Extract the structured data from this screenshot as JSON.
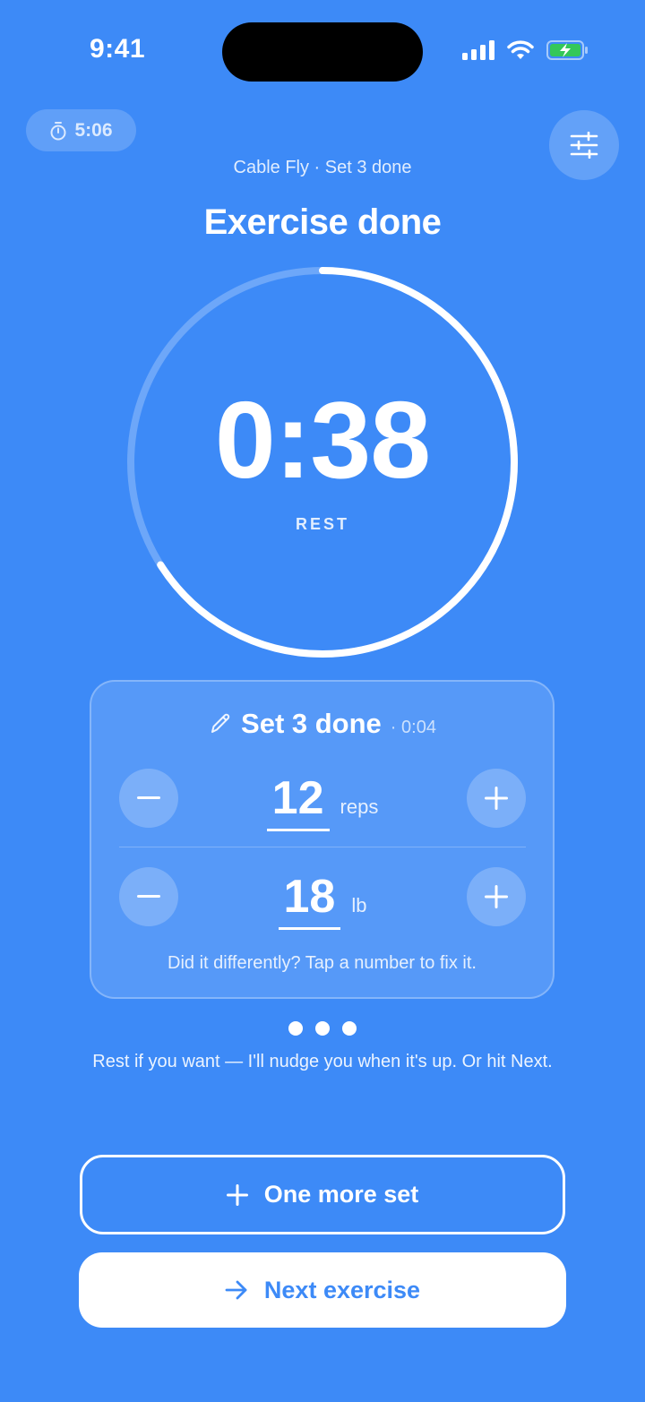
{
  "status_bar": {
    "time": "9:41",
    "icons": [
      "cellular-signal-icon",
      "wifi-icon",
      "battery-charging-icon"
    ],
    "battery_color": "#34c759"
  },
  "workout_timer": {
    "icon": "stopwatch-icon",
    "elapsed": "5:06"
  },
  "settings_icon": "sliders-icon",
  "header": {
    "subtitle": "Cable Fly · Set 3 done",
    "title": "Exercise done"
  },
  "rest_timer": {
    "time": "0:38",
    "label": "REST",
    "progress_remaining": 0.66
  },
  "set_card": {
    "icon": "pencil-icon",
    "title": "Set 3 done",
    "meta": "· 0:04",
    "rows": [
      {
        "value": "12",
        "unit": "reps",
        "minus_icon": "minus-icon",
        "plus_icon": "plus-icon"
      },
      {
        "value": "18",
        "unit": "lb",
        "minus_icon": "minus-icon",
        "plus_icon": "plus-icon"
      }
    ],
    "hint": "Did it differently? Tap a number to fix it."
  },
  "pager": {
    "count": 3
  },
  "nudge_text": "Rest if you want — I'll nudge you when it's up. Or hit Next.",
  "actions": {
    "one_more": {
      "label": "One more set",
      "icon": "plus-icon"
    },
    "next": {
      "label": "Next exercise",
      "icon": "arrow-right-icon"
    }
  },
  "colors": {
    "background": "#3d8af7",
    "foreground": "#ffffff"
  }
}
